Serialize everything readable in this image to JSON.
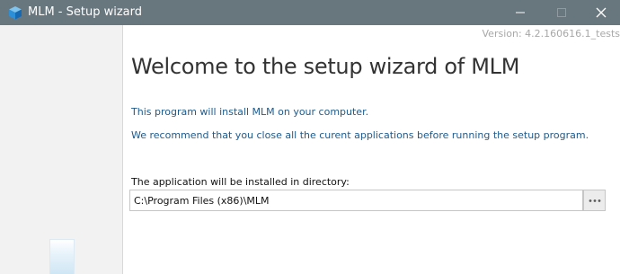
{
  "window": {
    "title": "MLM - Setup wizard",
    "icon": "cube-icon",
    "controls": [
      "minimize-icon",
      "maximize-icon",
      "close-icon"
    ],
    "titlebar_color": "#68767e"
  },
  "main": {
    "version": "Version: 4.2.160616.1_tests",
    "heading": "Welcome to the setup wizard of MLM",
    "info_line_1": "This program will install MLM on your computer.",
    "info_line_2": "We recommend that you close all the curent applications before running the setup program.",
    "install_dir": {
      "label": "The application will be installed in directory:",
      "value": "C:\\Program Files (x86)\\MLM",
      "browse_icon": "ellipsis-icon"
    },
    "info_color": "#1e5a8c"
  }
}
